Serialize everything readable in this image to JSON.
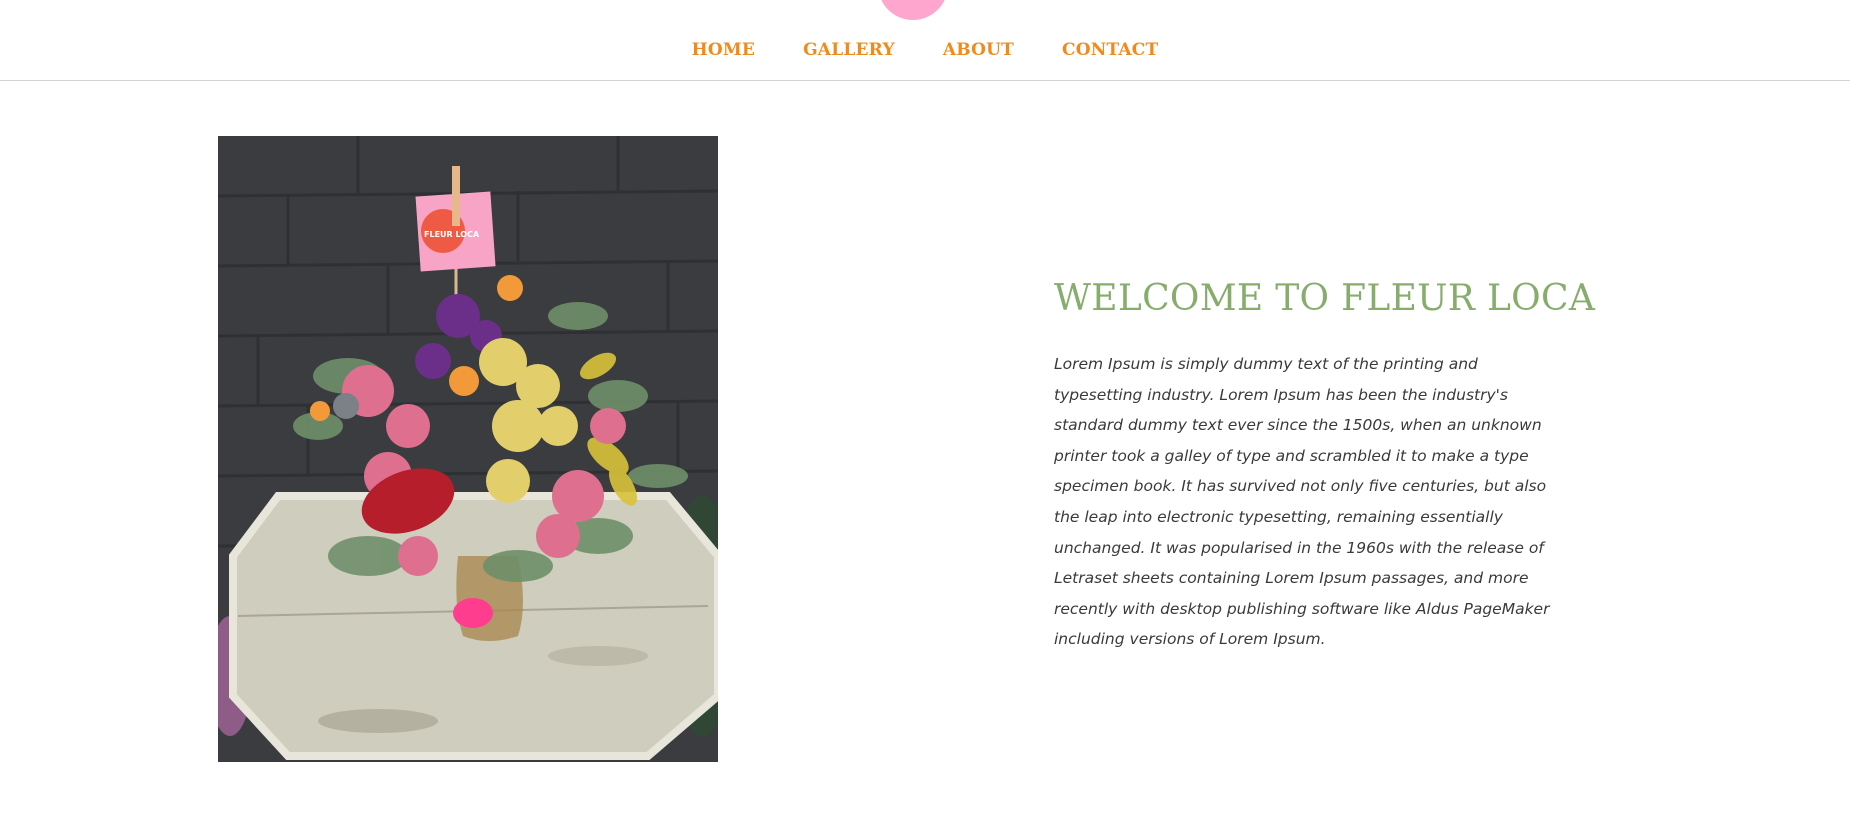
{
  "header": {
    "nav": [
      {
        "label": "HOME"
      },
      {
        "label": "GALLERY"
      },
      {
        "label": "ABOUT"
      },
      {
        "label": "CONTACT"
      }
    ]
  },
  "main": {
    "image": {
      "tag_text": "FLEUR LOCA"
    },
    "heading": "WELCOME TO FLEUR LOCA",
    "paragraph": "Lorem Ipsum is simply dummy text of the printing and typesetting industry. Lorem Ipsum has been the industry's standard dummy text ever since the 1500s, when an unknown printer took a galley of type and scrambled it to make a type specimen book. It has survived not only five centuries, but also the leap into electronic typesetting, remaining essentially unchanged. It was popularised in the 1960s with the release of Letraset sheets containing Lorem Ipsum passages, and more recently with desktop publishing software like Aldus PageMaker including versions of Lorem Ipsum."
  },
  "colors": {
    "nav_link": "#f28a1a",
    "heading": "#86ad6c",
    "logo": "#ffa6cf",
    "body_text": "#3a3a3a"
  }
}
